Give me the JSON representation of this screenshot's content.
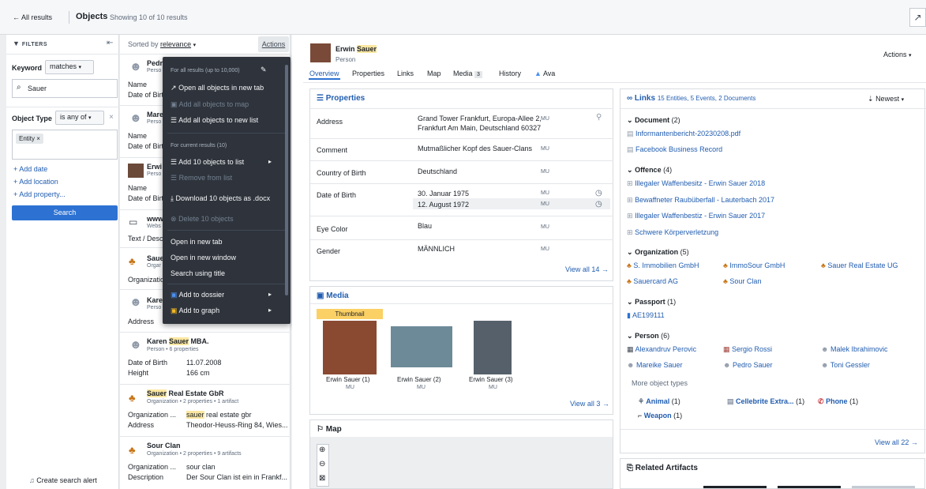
{
  "topbar": {
    "back": "All results",
    "title": "Objects",
    "subtitle": "Showing 10 of 10 results"
  },
  "filters": {
    "header": "FILTERS",
    "keyword_label": "Keyword",
    "keyword_mode": "matches",
    "keyword_value": "Sauer",
    "type_label": "Object Type",
    "type_mode": "is any of",
    "type_chip": "Entity",
    "add_date": "+ Add date",
    "add_location": "+ Add location",
    "add_property": "+ Add property...",
    "search": "Search",
    "create_alert": "Create search alert"
  },
  "results": {
    "sorted_prefix": "Sorted by",
    "sorted_value": "relevance",
    "actions": "Actions",
    "items": [
      {
        "title": "Pedr",
        "sub": "Perso",
        "k1": "Name",
        "k2": "Date of Birt"
      },
      {
        "title": "Marе",
        "sub": "Perso",
        "k1": "Name",
        "k2": "Date of Birt"
      },
      {
        "title": "Erwi",
        "sub": "Perso",
        "k1": "Name",
        "k2": "Date of Birt"
      },
      {
        "title": "www",
        "sub": "Webs",
        "k1": "Text / Desc"
      },
      {
        "title": "Saue",
        "sub": "Orgar",
        "k1": "Organizatio"
      },
      {
        "title": "Kare",
        "sub": "Perso",
        "k1": "Address"
      }
    ],
    "karen": {
      "title_pre": "Karen ",
      "title_hl": "Sauer",
      "title_post": " MBA.",
      "sub": "Person • 6 properties",
      "k1": "Date of Birth",
      "v1": "11.07.2008",
      "k2": "Height",
      "v2": "166 cm"
    },
    "sre": {
      "title_hl": "Sauer",
      "title_post": " Real Estate GbR",
      "sub": "Organization • 2 properties • 1 artifact",
      "k1": "Organization ...",
      "v1_hl": "sauer",
      "v1_post": " real estate gbr",
      "k2": "Address",
      "v2": "Theodor-Heuss-Ring 84, Wies..."
    },
    "sour": {
      "title": "Sour Clan",
      "sub": "Organization • 2 properties • 9 artifacts",
      "k1": "Organization ...",
      "v1": "sour clan",
      "k2": "Description",
      "v2": "Der Sour Clan ist ein in Frankf..."
    }
  },
  "menu": {
    "sec1": "For all results (up to 10,000)",
    "open_all": "Open all objects in new tab",
    "add_map": "Add all objects to map",
    "add_list": "Add all objects to new list",
    "sec2": "For current results (10)",
    "add10": "Add 10 objects to list",
    "remove": "Remove from list",
    "download": "Download 10 objects as .docx",
    "delete": "Delete 10 objects",
    "open_tab": "Open in new tab",
    "open_win": "Open in new window",
    "search_title": "Search using title",
    "dossier": "Add to dossier",
    "graph": "Add to graph"
  },
  "object": {
    "name_pre": "Erwin ",
    "name_hl": "Sauer",
    "type": "Person",
    "actions": "Actions",
    "tabs": [
      "Overview",
      "Properties",
      "Links",
      "Map",
      "Media",
      "History",
      "Ava"
    ],
    "media_count": "3"
  },
  "properties": {
    "title": "Properties",
    "rows": [
      {
        "k": "Address",
        "v": "Grand Tower Frankfurt, Europa-Allee 2,",
        "v2": "Frankfurt Am Main, Deutschland 60327",
        "mu": "MU"
      },
      {
        "k": "Comment",
        "v": "Mutmaßlicher Kopf des Sauer-Clans",
        "mu": "MU"
      },
      {
        "k": "Country of Birth",
        "v": "Deutschland",
        "mu": "MU"
      },
      {
        "k": "Date of Birth",
        "v": "30. Januar 1975",
        "v2": "12. August 1972",
        "mu": "MU"
      },
      {
        "k": "Eye Color",
        "v": "Blau",
        "mu": "MU"
      },
      {
        "k": "Gender",
        "v": "MÄNNLICH",
        "mu": "MU"
      }
    ],
    "view_all": "View all 14 →"
  },
  "media": {
    "title": "Media",
    "thumb_tag": "Thumbnail",
    "items": [
      {
        "name": "Erwin Sauer (1)",
        "mu": "MU"
      },
      {
        "name": "Erwin Sauer (2)",
        "mu": "MU"
      },
      {
        "name": "Erwin Sauer (3)",
        "mu": "MU"
      }
    ],
    "view_all": "View all 3 →"
  },
  "map": {
    "title": "Map"
  },
  "links": {
    "title": "Links",
    "summary": "15 Entities, 5 Events, 2 Documents",
    "sort": "Newest",
    "doc": {
      "h": "Document",
      "c": "(2)",
      "items": [
        "Informantenbericht-20230208.pdf",
        "Facebook Business Record"
      ]
    },
    "off": {
      "h": "Offence",
      "c": "(4)",
      "items": [
        "Illegaler Waffenbesitz - Erwin Sauer 2018",
        "Bewaffneter Raubüberfall - Lauterbach 2017",
        "Illegaler Waffenbestiz - Erwin Sauer 2017",
        "Schwere Körperverletzung"
      ]
    },
    "org": {
      "h": "Organization",
      "c": "(5)",
      "items": [
        "S. Immobilien GmbH",
        "ImmoSour GmbH",
        "Sauer Real Estate UG",
        "Sauercard AG",
        "Sour Clan"
      ]
    },
    "pass": {
      "h": "Passport",
      "c": "(1)",
      "items": [
        "AE199111"
      ]
    },
    "person": {
      "h": "Person",
      "c": "(6)",
      "items": [
        "Alexandruv Perovic",
        "Sergio Rossi",
        "Malek Ibrahimovic",
        "Mareike Sauer",
        "Pedro Sauer",
        "Toni Gessler"
      ]
    },
    "more": "More object types",
    "animal": "Animal",
    "animal_c": "(1)",
    "cell": "Cellebrite Extra...",
    "cell_c": "(1)",
    "phone": "Phone",
    "phone_c": "(1)",
    "weapon": "Weapon",
    "weapon_c": "(1)",
    "view_all": "View all 22 →"
  },
  "related": {
    "title": "Related Artifacts"
  }
}
